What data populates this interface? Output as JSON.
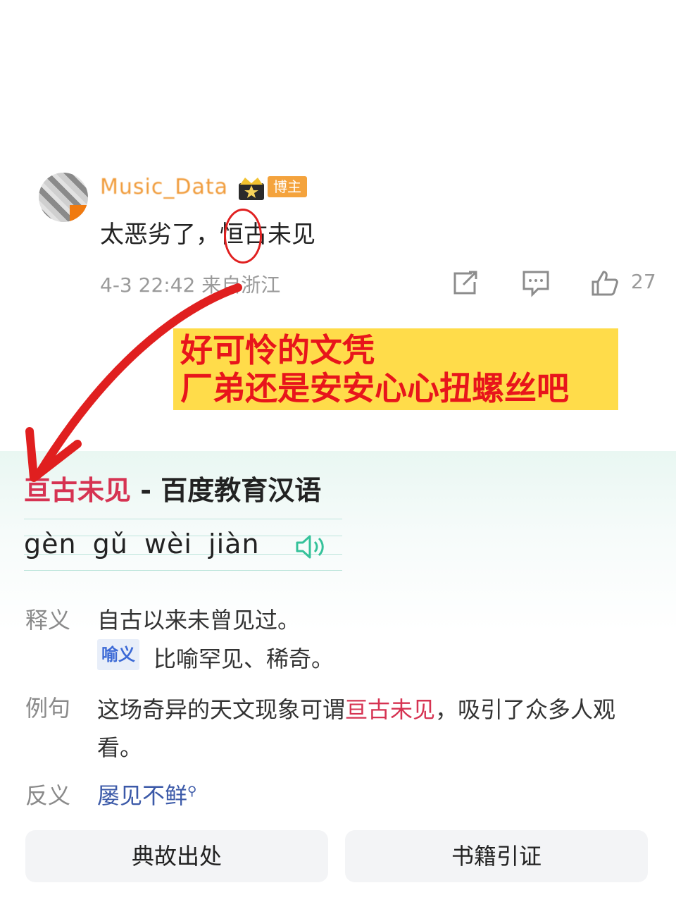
{
  "comment": {
    "username": "Music_Data",
    "badge": "博主",
    "text": "太恶劣了，恒古未见",
    "timestamp": "4-3 22:42",
    "source": "来自浙江",
    "like_count": "27"
  },
  "annotation": {
    "line1": "好可怜的文凭",
    "line2": "厂弟还是安安心心扭螺丝吧"
  },
  "dictionary": {
    "title_word": "亘古未见",
    "title_rest": " - 百度教育汉语",
    "pinyin": "gèn gǔ  wèi  jiàn",
    "definition_label": "释义",
    "definition": "自古以来未曾见过。",
    "figurative_tag": "喻义",
    "figurative": "比喻罕见、稀奇。",
    "example_label": "例句",
    "example_before": "这场奇异的天文现象可谓",
    "example_word": "亘古未见",
    "example_after": "，吸引了众多人观看。",
    "antonym_label": "反义",
    "antonym": "屡见不鲜",
    "buttons": [
      "典故出处",
      "书籍引证"
    ]
  },
  "colors": {
    "annotation_bg": "#ffdc4a",
    "annotation_text": "#e8151b",
    "highlight_word": "#d63352",
    "badge": "#f4a33d"
  }
}
